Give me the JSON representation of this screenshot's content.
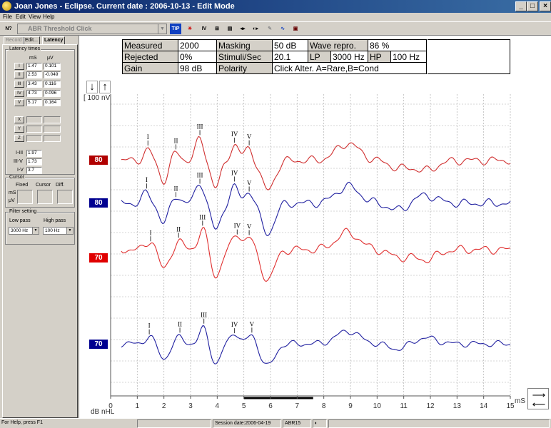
{
  "window": {
    "title": "Joan Jones - Eclipse. Current date : 2006-10-13 - Edit Mode",
    "buttons": {
      "minimize": "_",
      "maximize": "□",
      "close": "×"
    }
  },
  "menu": {
    "items": [
      "File",
      "Edit",
      "View",
      "Help"
    ]
  },
  "toolbar": {
    "test_select": "ABR Threshold Click",
    "icons": [
      {
        "name": "help-pointer-icon",
        "glyph": "N?"
      },
      {
        "name": "tip-icon",
        "glyph": "TIP"
      },
      {
        "name": "marker-icon",
        "glyph": "✳"
      },
      {
        "name": "iv-icon",
        "glyph": "IV"
      },
      {
        "name": "waveform-sum-icon",
        "glyph": "⊞"
      },
      {
        "name": "print-icon",
        "glyph": "▤"
      },
      {
        "name": "connect-icon",
        "glyph": "◂▸"
      },
      {
        "name": "compare-icon",
        "glyph": "◐▸"
      },
      {
        "name": "edit-wave-icon",
        "glyph": "✎"
      },
      {
        "name": "report-icon",
        "glyph": "∿"
      },
      {
        "name": "save-icon",
        "glyph": "▣"
      }
    ]
  },
  "left_panel": {
    "tabs": [
      "Record",
      "Edit...",
      "Latency"
    ],
    "latency_group": {
      "title": "Latency times",
      "col_ms": "mS",
      "col_uv": "μV",
      "rows": [
        {
          "label": "I",
          "ms": "1.47",
          "uv": "0.101"
        },
        {
          "label": "II",
          "ms": "2.53",
          "uv": "-0.049"
        },
        {
          "label": "III",
          "ms": "3.43",
          "uv": "0.116"
        },
        {
          "label": "IV",
          "ms": "4.73",
          "uv": "0.096"
        },
        {
          "label": "V",
          "ms": "5.17",
          "uv": "0.164"
        }
      ],
      "extra_rows": [
        "X",
        "Y",
        "Z"
      ],
      "intervals": [
        {
          "label": "I-III",
          "value": "1.97"
        },
        {
          "label": "III-V",
          "value": "1.73"
        },
        {
          "label": "I-V",
          "value": "3.7"
        }
      ]
    },
    "cursor_group": {
      "title": "Cursor",
      "cols": [
        "Fixed",
        "Cursor",
        "Diff."
      ],
      "rows": [
        "mS",
        "μV"
      ]
    },
    "filter_group": {
      "title": "Filter setting",
      "low_label": "Low pass",
      "high_label": "High pass",
      "low_value": "3000 Hz",
      "high_value": "100 Hz"
    }
  },
  "info": {
    "measured_label": "Measured",
    "measured_value": "2000",
    "masking_label": "Masking",
    "masking_value": "50 dB",
    "wave_repro_label": "Wave repro.",
    "wave_repro_value": "86 %",
    "rejected_label": "Rejected",
    "rejected_value": "0%",
    "stimuli_label": "Stimuli/Sec",
    "stimuli_value": "20.1",
    "lp_label": "LP",
    "lp_value": "3000 Hz",
    "hp_label": "HP",
    "hp_value": "100 Hz",
    "gain_label": "Gain",
    "gain_value": "98 dB",
    "polarity_label": "Polarity",
    "polarity_value": "Click Alter. A=Rare,B=Cond"
  },
  "plot": {
    "scale_label": "[ 100 nV",
    "x_unit": "mS",
    "y_unit": "dB nHL",
    "x_ticks": [
      "0",
      "1",
      "2",
      "3",
      "4",
      "5",
      "6",
      "7",
      "8",
      "9",
      "10",
      "11",
      "12",
      "13",
      "14",
      "15"
    ],
    "waves": [
      {
        "level": "80",
        "color": "#d03030",
        "label_bg": "#b00000",
        "peaks": [
          {
            "label": "I",
            "ms": 1.4
          },
          {
            "label": "II",
            "ms": 2.45
          },
          {
            "label": "III",
            "ms": 3.35
          },
          {
            "label": "IV",
            "ms": 4.65
          },
          {
            "label": "V",
            "ms": 5.2
          }
        ]
      },
      {
        "level": "80",
        "color": "#2020a0",
        "label_bg": "#000090",
        "peaks": [
          {
            "label": "I",
            "ms": 1.35
          },
          {
            "label": "II",
            "ms": 2.45
          },
          {
            "label": "III",
            "ms": 3.35
          },
          {
            "label": "IV",
            "ms": 4.65
          },
          {
            "label": "V",
            "ms": 5.2
          }
        ]
      },
      {
        "level": "70",
        "color": "#e03030",
        "label_bg": "#e00000",
        "peaks": [
          {
            "label": "I",
            "ms": 1.5
          },
          {
            "label": "II",
            "ms": 2.55
          },
          {
            "label": "III",
            "ms": 3.45
          },
          {
            "label": "IV",
            "ms": 4.75
          },
          {
            "label": "V",
            "ms": 5.2
          }
        ]
      },
      {
        "level": "70",
        "color": "#2020a0",
        "label_bg": "#000090",
        "peaks": [
          {
            "label": "I",
            "ms": 1.45
          },
          {
            "label": "II",
            "ms": 2.6
          },
          {
            "label": "III",
            "ms": 3.5
          },
          {
            "label": "IV",
            "ms": 4.65
          },
          {
            "label": "V",
            "ms": 5.3
          }
        ]
      }
    ]
  },
  "status": {
    "help": "For Help, press F1",
    "session": "Session date:2006-04-19",
    "test": "ABR15"
  }
}
